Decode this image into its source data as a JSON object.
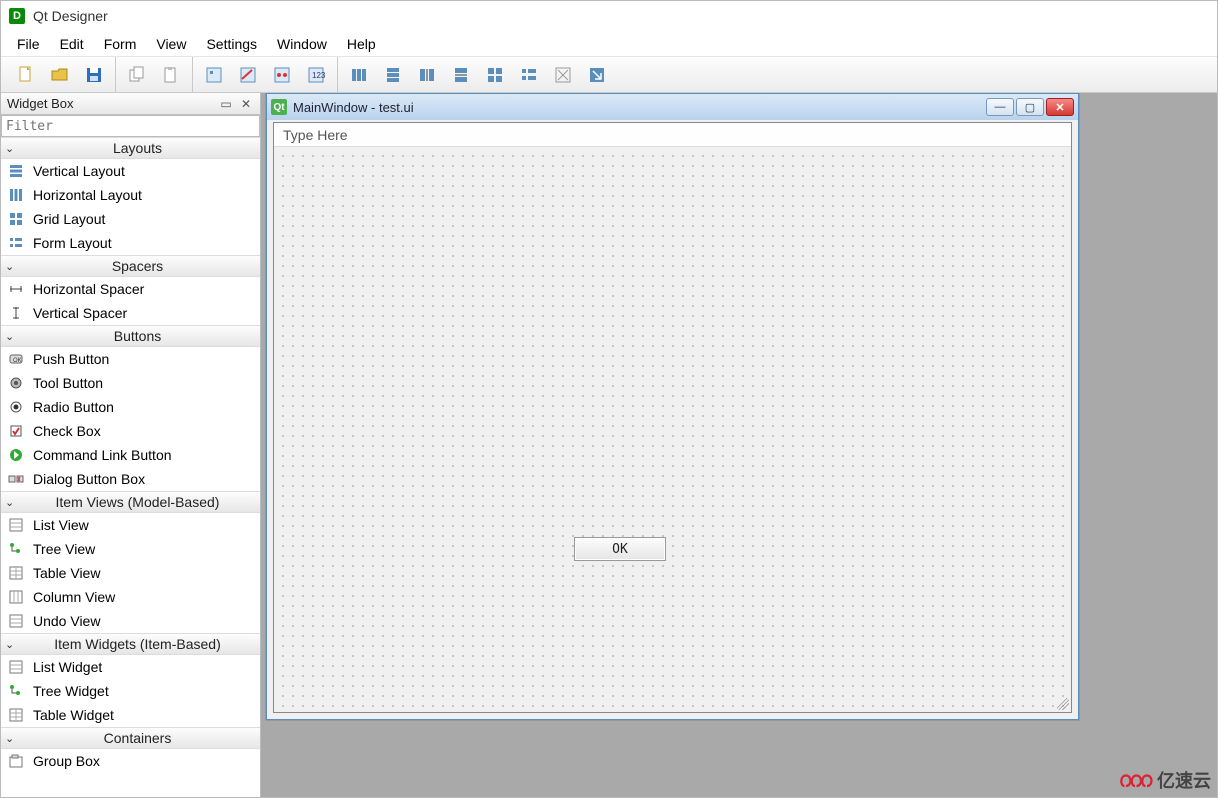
{
  "app": {
    "title": "Qt Designer"
  },
  "menu": {
    "items": [
      "File",
      "Edit",
      "Form",
      "View",
      "Settings",
      "Window",
      "Help"
    ]
  },
  "toolbar": {
    "g1": [
      "new",
      "open",
      "save"
    ],
    "g2": [
      "copy",
      "paste"
    ],
    "g3": [
      "edit-widgets",
      "edit-signals",
      "edit-buddies",
      "edit-tab-order"
    ],
    "g4": [
      "layout-h",
      "layout-v",
      "layout-hsplit",
      "layout-vsplit",
      "layout-grid",
      "layout-form",
      "break-layout",
      "adjust-size"
    ]
  },
  "dock": {
    "title": "Widget Box",
    "filter_placeholder": "Filter",
    "categories": [
      {
        "name": "Layouts",
        "items": [
          "Vertical Layout",
          "Horizontal Layout",
          "Grid Layout",
          "Form Layout"
        ]
      },
      {
        "name": "Spacers",
        "items": [
          "Horizontal Spacer",
          "Vertical Spacer"
        ]
      },
      {
        "name": "Buttons",
        "items": [
          "Push Button",
          "Tool Button",
          "Radio Button",
          "Check Box",
          "Command Link Button",
          "Dialog Button Box"
        ]
      },
      {
        "name": "Item Views (Model-Based)",
        "items": [
          "List View",
          "Tree View",
          "Table View",
          "Column View",
          "Undo View"
        ]
      },
      {
        "name": "Item Widgets (Item-Based)",
        "items": [
          "List Widget",
          "Tree Widget",
          "Table Widget"
        ]
      },
      {
        "name": "Containers",
        "items": [
          "Group Box"
        ]
      }
    ]
  },
  "subwindow": {
    "title": "MainWindow - test.ui",
    "type_here": "Type Here",
    "ok_label": "OK"
  },
  "watermark": "亿速云"
}
